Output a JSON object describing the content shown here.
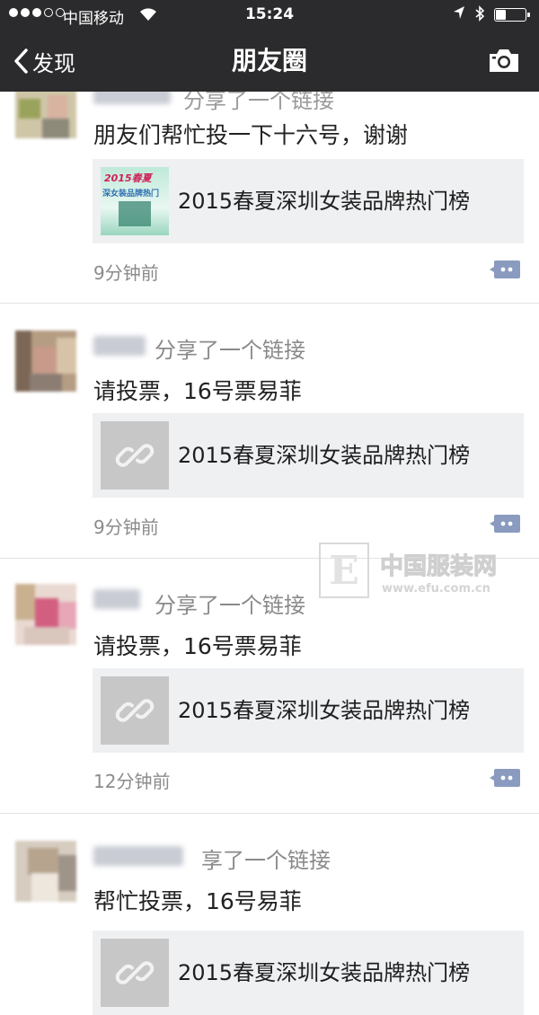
{
  "status_bar": {
    "carrier": "中国移动",
    "time": "15:24",
    "battery_level": 0.35
  },
  "nav": {
    "back_label": "发现",
    "title": "朋友圈"
  },
  "posts": [
    {
      "shared_text": "分享了一个链接",
      "text": "朋友们帮忙投一下十六号，谢谢",
      "link_title": "2015春夏深圳女装品牌热门榜",
      "time": "9分钟前",
      "poster_text": "2015春夏",
      "poster_sub": "深女装品牌热门"
    },
    {
      "shared_text": "分享了一个链接",
      "text": "请投票，16号票易菲",
      "link_title": "2015春夏深圳女装品牌热门榜",
      "time": "9分钟前"
    },
    {
      "shared_text": "分享了一个链接",
      "text": "请投票，16号票易菲",
      "link_title": "2015春夏深圳女装品牌热门榜",
      "time": "12分钟前"
    },
    {
      "shared_text": "享了一个链接",
      "text": "帮忙投票，16号易菲",
      "link_title": "2015春夏深圳女装品牌热门榜"
    }
  ],
  "watermark": {
    "name": "中国服装网",
    "url": "www.efu.com.cn",
    "letter": "E"
  },
  "colors": {
    "header_bg": "#2b2b2d",
    "comment_icon": "#8a9bbf",
    "card_bg": "#eff0f2"
  }
}
